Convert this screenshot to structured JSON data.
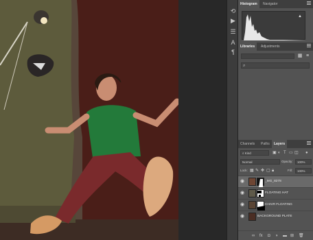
{
  "panels": {
    "histogram_tabs": [
      "Histogram",
      "Navigator"
    ],
    "libraries_tabs": [
      "Libraries",
      "Adjustments"
    ],
    "layers_tabs": [
      "Channels",
      "Paths",
      "Layers"
    ],
    "filter_kind": "Kind",
    "blend_mode": "Normal",
    "opacity_label": "Opacity:",
    "opacity_value": "100%",
    "lock_label": "Lock:",
    "fill_label": "Fill:",
    "fill_value": "100%",
    "layers": [
      {
        "name": "_MG_8278",
        "selected": true
      },
      {
        "name": "FLOATING HAT",
        "selected": false
      },
      {
        "name": "CHAIR FLOATING",
        "selected": false
      },
      {
        "name": "BACKGROUND PLATE",
        "selected": false
      }
    ]
  },
  "icons": {
    "eye": "eye-icon",
    "search": "search-icon",
    "menu": "panel-menu-icon",
    "grid": "grid-view-icon",
    "list": "list-view-icon"
  },
  "colors": {
    "panel_bg": "#535353",
    "tab_bar": "#3e3e3e",
    "selected_layer": "#6a6a6a"
  }
}
